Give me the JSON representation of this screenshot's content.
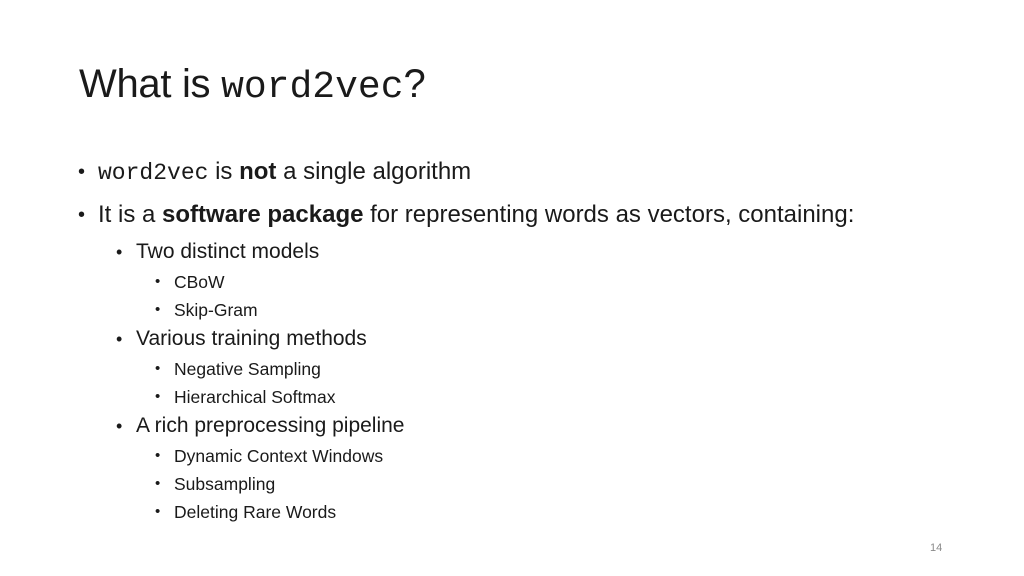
{
  "slide": {
    "title": {
      "prefix": "What is ",
      "code": "word2vec",
      "suffix": "?"
    },
    "bullets": [
      {
        "level": 1,
        "parts": [
          {
            "text": "word2vec",
            "style": "mono"
          },
          {
            "text": " is ",
            "style": "normal"
          },
          {
            "text": "not",
            "style": "bold"
          },
          {
            "text": " a single algorithm",
            "style": "normal"
          }
        ]
      },
      {
        "level": 1,
        "parts": [
          {
            "text": "It is a ",
            "style": "normal"
          },
          {
            "text": "software package",
            "style": "bold"
          },
          {
            "text": " for representing words as vectors, containing:",
            "style": "normal"
          }
        ]
      },
      {
        "level": 2,
        "text": "Two distinct models"
      },
      {
        "level": 3,
        "text": "CBoW"
      },
      {
        "level": 3,
        "text": "Skip-Gram"
      },
      {
        "level": 2,
        "text": "Various training methods"
      },
      {
        "level": 3,
        "text": "Negative Sampling"
      },
      {
        "level": 3,
        "text": "Hierarchical Softmax"
      },
      {
        "level": 2,
        "text": "A rich preprocessing pipeline"
      },
      {
        "level": 3,
        "text": "Dynamic Context Windows"
      },
      {
        "level": 3,
        "text": "Subsampling"
      },
      {
        "level": 3,
        "text": "Deleting Rare Words"
      }
    ],
    "bullet_glyph": "•",
    "page_number": "14"
  }
}
